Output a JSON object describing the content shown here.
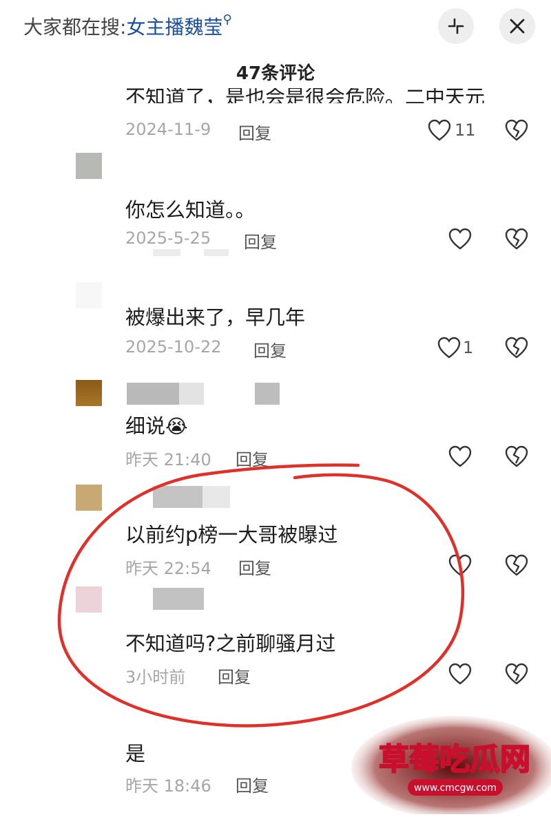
{
  "header": {
    "search_prefix": "大家都在搜:",
    "search_keyword": "女主播魏莹",
    "search_icon": "search-icon",
    "collapse_icon": "collapse-icon",
    "close_icon": "close-icon",
    "comment_count": "47条评论"
  },
  "cut_off_text": "不知道了，是也会是很会危险。二中天元",
  "comments": [
    {
      "text": "",
      "time": "2024-11-9",
      "reply": "回复",
      "likes": "11"
    },
    {
      "text": "你怎么知道。。",
      "time": "2025-5-25",
      "reply": "回复",
      "likes": ""
    },
    {
      "text": "被爆出来了，早几年",
      "time": "2025-10-22",
      "reply": "回复",
      "likes": "1"
    },
    {
      "text": "细说",
      "emoji": "😭",
      "time": "昨天 21:40",
      "reply": "回复",
      "likes": ""
    },
    {
      "text": "以前约p榜一大哥被曝过",
      "time": "昨天 22:54",
      "reply": "回复",
      "likes": ""
    },
    {
      "text": "不知道吗?之前聊骚月过",
      "time": "3小时前",
      "reply": "回复",
      "likes": ""
    },
    {
      "text": "是",
      "time": "昨天 18:46",
      "reply": "回复",
      "likes": ""
    }
  ],
  "watermark": {
    "title": "草莓吃瓜网",
    "url": "www.cmcgw.com"
  },
  "colors": {
    "keyword": "#1a4f9e",
    "annotation": "#e0302a",
    "watermark": "#c8102e"
  }
}
